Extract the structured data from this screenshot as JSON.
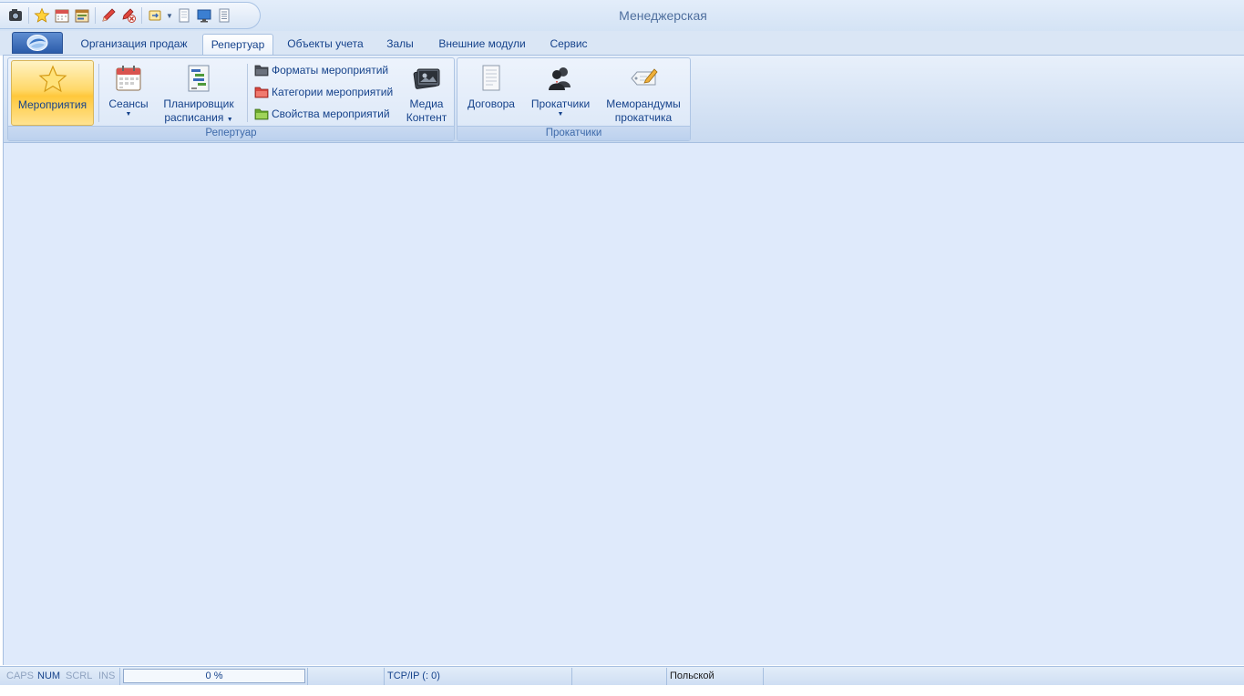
{
  "window": {
    "title": "Менеджерская"
  },
  "quick_access": {
    "icons": [
      "camera-icon",
      "star-icon",
      "calendar-icon",
      "schedule-icon",
      "edit-icon",
      "delete-icon",
      "export-icon",
      "dropdown-arrow-icon",
      "document-icon",
      "monitor-icon",
      "list-icon"
    ]
  },
  "tabs": [
    {
      "label": "Организация продаж",
      "active": false
    },
    {
      "label": "Репертуар",
      "active": true
    },
    {
      "label": "Объекты учета",
      "active": false
    },
    {
      "label": "Залы",
      "active": false
    },
    {
      "label": "Внешние модули",
      "active": false
    },
    {
      "label": "Сервис",
      "active": false
    }
  ],
  "ribbon": {
    "repertoire_group": {
      "label": "Репертуар",
      "events": {
        "label": "Мероприятия",
        "icon": "star-icon"
      },
      "sessions": {
        "label": "Сеансы",
        "icon": "calendar-icon"
      },
      "scheduler": {
        "line1": "Планировщик",
        "line2": "расписания",
        "icon": "gantt-icon"
      },
      "formats": {
        "label": "Форматы мероприятий",
        "icon": "folder-dark-icon"
      },
      "categories": {
        "label": "Категории мероприятий",
        "icon": "folder-red-icon"
      },
      "properties": {
        "label": "Свойства мероприятий",
        "icon": "folder-green-icon"
      },
      "media": {
        "line1": "Медиа",
        "line2": "Контент",
        "icon": "photos-icon"
      }
    },
    "distributors_group": {
      "label": "Прокатчики",
      "contracts": {
        "label": "Договора",
        "icon": "contract-icon"
      },
      "distributors": {
        "label": "Прокатчики",
        "icon": "people-icon"
      },
      "memos": {
        "line1": "Меморандумы",
        "line2": "прокатчика",
        "icon": "memo-icon"
      }
    }
  },
  "statusbar": {
    "caps": "CAPS",
    "num": "NUM",
    "scrl": "SCRL",
    "ins": "INS",
    "progress_text": "0 %",
    "progress_fraction": 0,
    "connection": "TCP/IP (: 0)",
    "language": "Польской"
  },
  "colors": {
    "accent": "#15428b",
    "workspace": "#dfeafb",
    "selected": "#ffd868"
  }
}
